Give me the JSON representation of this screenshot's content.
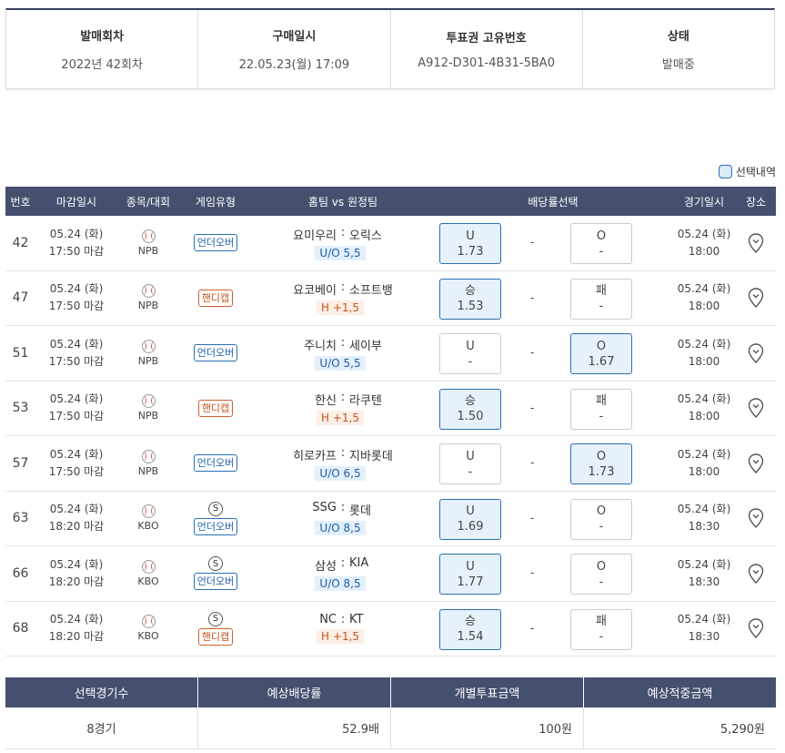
{
  "info": {
    "round_label": "발매회차",
    "round_value": "2022년 42회차",
    "purchase_label": "구매일시",
    "purchase_value": "22.05.23(월) 17:09",
    "ticket_label": "투표권 고유번호",
    "ticket_value": "A912-D301-4B31-5BA0",
    "status_label": "상태",
    "status_value": "발매중"
  },
  "legend": {
    "label": "선택내역"
  },
  "table": {
    "headers": {
      "no": "번호",
      "deadline": "마감일시",
      "sport": "종목/대회",
      "type": "게임유형",
      "teams": "홈팀 vs 원정팀",
      "odds": "배당률선택",
      "game_date": "경기일시",
      "place": "장소"
    },
    "rows": [
      {
        "no": "42",
        "d1": "05.24 (화)",
        "d2": "17:50 마감",
        "league": "NPB",
        "special": "",
        "type": "언더오버",
        "type_kind": "uo",
        "home": "요미우리",
        "away": "오릭스",
        "hcap": "U/O 5,5",
        "left_label": "U",
        "left_odds": "1.73",
        "left_sel": true,
        "mid": "-",
        "right_label": "O",
        "right_odds": "-",
        "right_sel": false,
        "g1": "05.24 (화)",
        "g2": "18:00"
      },
      {
        "no": "47",
        "d1": "05.24 (화)",
        "d2": "17:50 마감",
        "league": "NPB",
        "special": "",
        "type": "핸디캡",
        "type_kind": "hd",
        "home": "요코베이",
        "away": "소프트뱅",
        "hcap": "H +1,5",
        "left_label": "승",
        "left_odds": "1.53",
        "left_sel": true,
        "mid": "-",
        "right_label": "패",
        "right_odds": "-",
        "right_sel": false,
        "g1": "05.24 (화)",
        "g2": "18:00"
      },
      {
        "no": "51",
        "d1": "05.24 (화)",
        "d2": "17:50 마감",
        "league": "NPB",
        "special": "",
        "type": "언더오버",
        "type_kind": "uo",
        "home": "주니치",
        "away": "세이부",
        "hcap": "U/O 5,5",
        "left_label": "U",
        "left_odds": "-",
        "left_sel": false,
        "mid": "-",
        "right_label": "O",
        "right_odds": "1.67",
        "right_sel": true,
        "g1": "05.24 (화)",
        "g2": "18:00"
      },
      {
        "no": "53",
        "d1": "05.24 (화)",
        "d2": "17:50 마감",
        "league": "NPB",
        "special": "",
        "type": "핸디캡",
        "type_kind": "hd",
        "home": "한신",
        "away": "라쿠텐",
        "hcap": "H +1,5",
        "left_label": "승",
        "left_odds": "1.50",
        "left_sel": true,
        "mid": "-",
        "right_label": "패",
        "right_odds": "-",
        "right_sel": false,
        "g1": "05.24 (화)",
        "g2": "18:00"
      },
      {
        "no": "57",
        "d1": "05.24 (화)",
        "d2": "17:50 마감",
        "league": "NPB",
        "special": "",
        "type": "언더오버",
        "type_kind": "uo",
        "home": "히로카프",
        "away": "지바롯데",
        "hcap": "U/O 6,5",
        "left_label": "U",
        "left_odds": "-",
        "left_sel": false,
        "mid": "-",
        "right_label": "O",
        "right_odds": "1.73",
        "right_sel": true,
        "g1": "05.24 (화)",
        "g2": "18:00"
      },
      {
        "no": "63",
        "d1": "05.24 (화)",
        "d2": "18:20 마감",
        "league": "KBO",
        "special": "S",
        "type": "언더오버",
        "type_kind": "uo",
        "home": "SSG",
        "away": "롯데",
        "hcap": "U/O 8,5",
        "left_label": "U",
        "left_odds": "1.69",
        "left_sel": true,
        "mid": "-",
        "right_label": "O",
        "right_odds": "-",
        "right_sel": false,
        "g1": "05.24 (화)",
        "g2": "18:30"
      },
      {
        "no": "66",
        "d1": "05.24 (화)",
        "d2": "18:20 마감",
        "league": "KBO",
        "special": "S",
        "type": "언더오버",
        "type_kind": "uo",
        "home": "삼성",
        "away": "KIA",
        "hcap": "U/O 8,5",
        "left_label": "U",
        "left_odds": "1.77",
        "left_sel": true,
        "mid": "-",
        "right_label": "O",
        "right_odds": "-",
        "right_sel": false,
        "g1": "05.24 (화)",
        "g2": "18:30"
      },
      {
        "no": "68",
        "d1": "05.24 (화)",
        "d2": "18:20 마감",
        "league": "KBO",
        "special": "S",
        "type": "핸디캡",
        "type_kind": "hd",
        "home": "NC",
        "away": "KT",
        "hcap": "H +1,5",
        "left_label": "승",
        "left_odds": "1.54",
        "left_sel": true,
        "mid": "-",
        "right_label": "패",
        "right_odds": "-",
        "right_sel": false,
        "g1": "05.24 (화)",
        "g2": "18:30"
      }
    ]
  },
  "summary": {
    "headers": [
      "선택경기수",
      "예상배당률",
      "개별투표금액",
      "예상적중금액"
    ],
    "values": [
      "8경기",
      "52.9배",
      "100원",
      "5,290원"
    ]
  },
  "colors": {
    "header_bg": "#45506f",
    "selected_bg": "#e6f1fb",
    "selected_border": "#2a6fb5",
    "uo_color": "#1e5fa8",
    "handicap_color": "#c45520"
  },
  "icons": {
    "sport": "baseball-icon",
    "place": "map-pin-icon"
  }
}
